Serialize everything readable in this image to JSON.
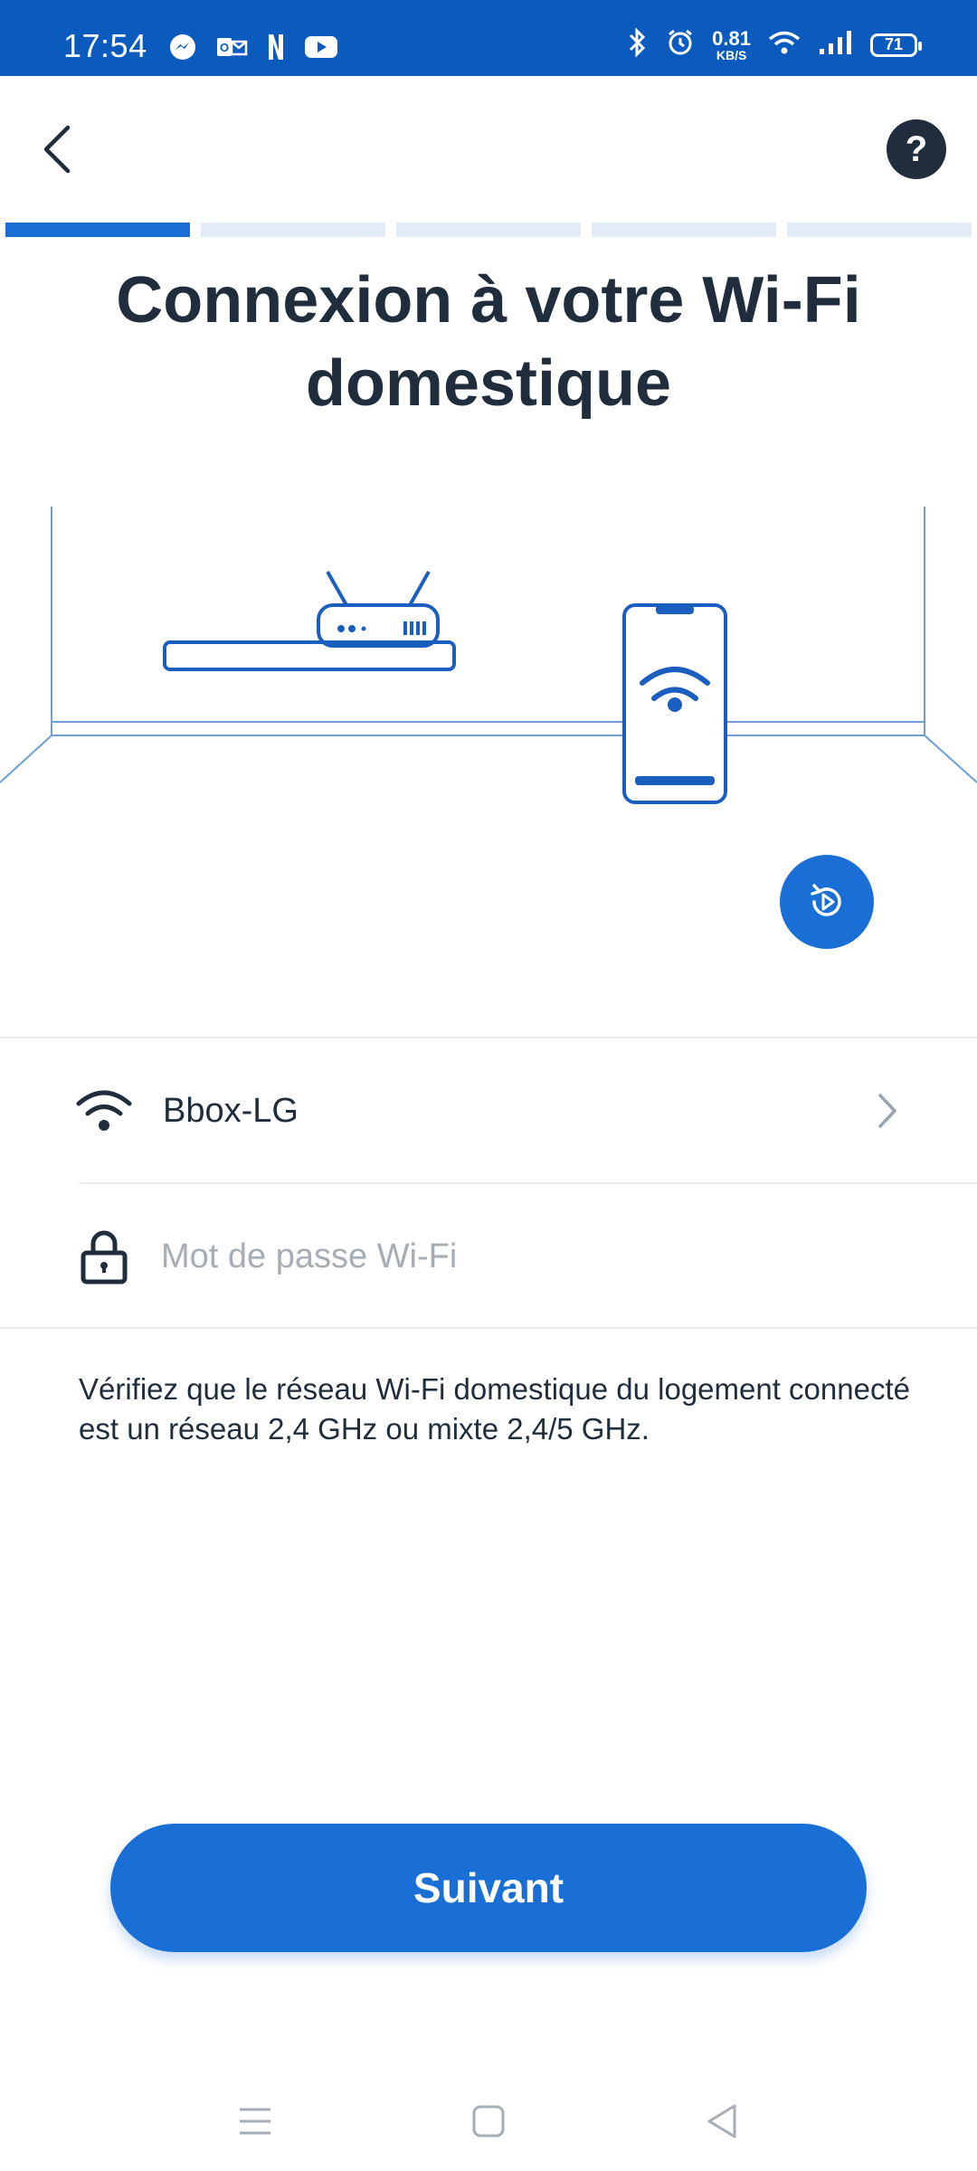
{
  "status_bar": {
    "time": "17:54",
    "net_speed_value": "0.81",
    "net_speed_unit": "KB/S",
    "battery": "71",
    "left_icons": [
      "messenger-icon",
      "outlook-icon",
      "netflix-icon",
      "youtube-icon"
    ],
    "right_icons": [
      "bluetooth-icon",
      "alarm-icon",
      "wifi-icon",
      "signal-icon",
      "battery-icon"
    ]
  },
  "header": {
    "back_icon": "back-arrow-icon",
    "help_label": "?"
  },
  "progress": {
    "total_steps": 5,
    "current_step": 1
  },
  "title": "Connexion à votre Wi-Fi domestique",
  "illustration": {
    "icons": [
      "router-icon",
      "phone-wifi-icon"
    ]
  },
  "replay_icon": "replay-icon",
  "network_row": {
    "icon": "wifi-icon",
    "name": "Bbox-LG",
    "chevron_icon": "chevron-right-icon"
  },
  "password_row": {
    "icon": "lock-icon",
    "placeholder": "Mot de passe Wi-Fi",
    "value": ""
  },
  "hint": "Vérifiez que le réseau Wi-Fi domestique du logement connecté est un réseau 2,4 GHz ou mixte 2,4/5 GHz.",
  "next_button": "Suivant",
  "nav_bar": {
    "icons": [
      "menu-icon",
      "home-icon",
      "back-icon"
    ]
  },
  "colors": {
    "status_bar": "#0b5bbf",
    "accent": "#1a6fd6",
    "progress_inactive": "#e2ecf8",
    "text": "#1f2d3d",
    "placeholder": "#a7adb5"
  }
}
